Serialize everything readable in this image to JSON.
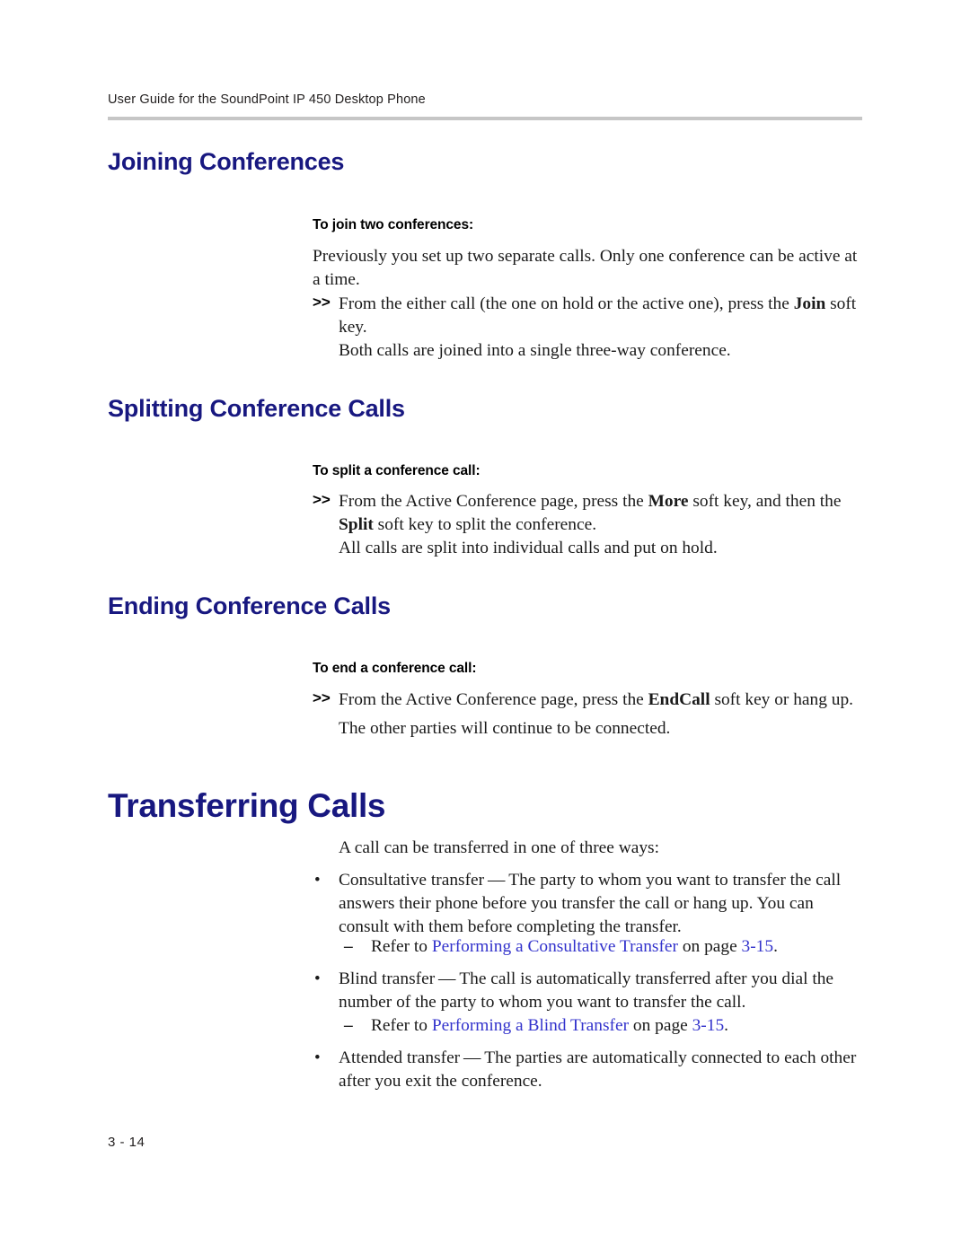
{
  "document": {
    "running_header": "User Guide for the SoundPoint IP 450 Desktop Phone",
    "folio": "3 - 14",
    "colors": {
      "heading": "#181880",
      "crossref_link": "#3333cc",
      "header_rule": "#c6c6c6",
      "body_text": "#1a1a1a"
    }
  },
  "sections": {
    "joining_conferences": {
      "heading": "Joining Conferences",
      "procedure_title": "To join two conferences:",
      "intro": "Previously you set up two separate calls. Only one conference can be active at a time.",
      "step_marker": ">>",
      "step_text_part1": "From the either call (the one on hold or the active one), press the ",
      "step_bold": "Join",
      "step_text_part2": " soft key.",
      "result": "Both calls are joined into a single three-way conference."
    },
    "splitting_conference_calls": {
      "heading": "Splitting Conference Calls",
      "procedure_title": "To split a conference call:",
      "step_marker": ">>",
      "step_text_part1": "From the Active Conference page, press the ",
      "step_bold1": "More",
      "step_text_part2": " soft key, and then the ",
      "step_bold2": "Split",
      "step_text_part3": " soft key to split the conference.",
      "result": "All calls are split into individual calls and put on hold."
    },
    "ending_conference_calls": {
      "heading": "Ending Conference Calls",
      "procedure_title": "To end a conference call:",
      "step_marker": ">>",
      "step_text_part1": "From the Active Conference page, press the ",
      "step_bold": "EndCall",
      "step_text_part2": " soft key or hang up.",
      "result": "The other parties will continue to be connected."
    },
    "transferring_calls": {
      "heading": "Transferring Calls",
      "intro": "A call can be transferred in one of three ways:",
      "bullets": [
        {
          "marker": "•",
          "text": "Consultative transfer — The party to whom you want to transfer the call answers their phone before you transfer the call or hang up. You can consult with them before completing the transfer.",
          "crossref": {
            "dash": "–",
            "prefix": "Refer to ",
            "link": "Performing a Consultative Transfer",
            "middle": " on page ",
            "page_link": "3-15",
            "suffix": "."
          }
        },
        {
          "marker": "•",
          "text": "Blind transfer — The call is automatically transferred after you dial the number of the party to whom you want to transfer the call.",
          "crossref": {
            "dash": "–",
            "prefix": "Refer to ",
            "link": "Performing a Blind Transfer",
            "middle": " on page ",
            "page_link": "3-15",
            "suffix": "."
          }
        },
        {
          "marker": "•",
          "text": "Attended transfer — The parties are automatically connected to each other after you exit the conference.",
          "crossref": null
        }
      ]
    }
  }
}
